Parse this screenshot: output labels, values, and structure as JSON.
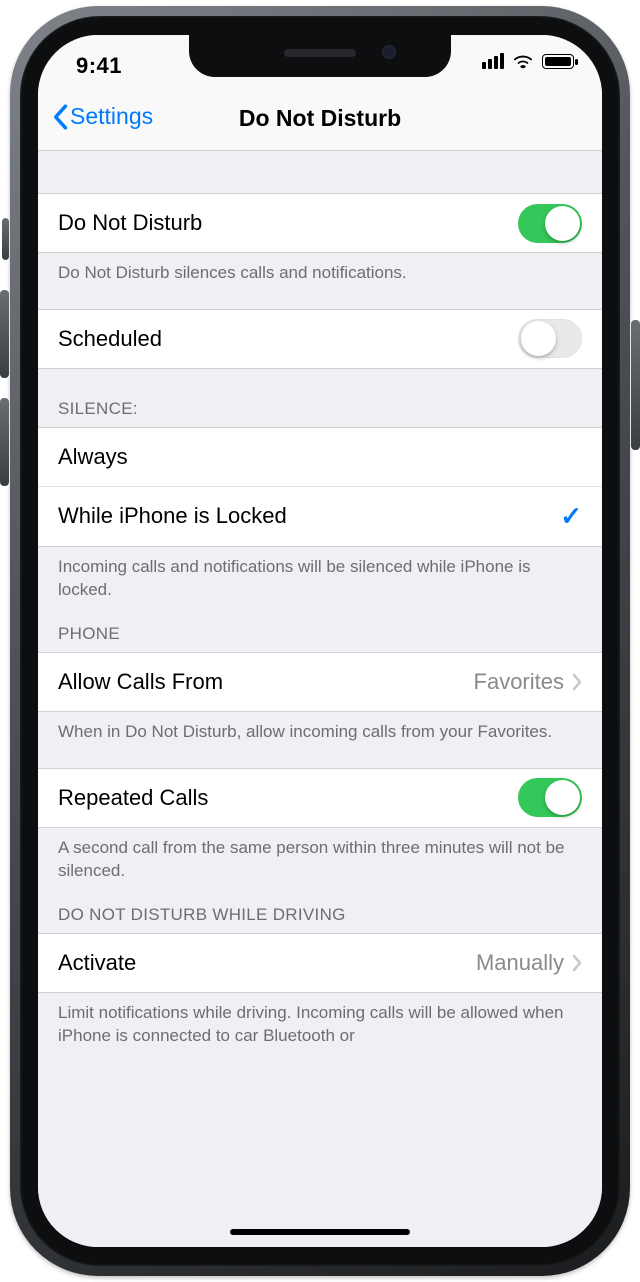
{
  "statusbar": {
    "time": "9:41"
  },
  "nav": {
    "back_label": "Settings",
    "title": "Do Not Disturb"
  },
  "section1": {
    "dnd_label": "Do Not Disturb",
    "dnd_on": true,
    "dnd_footer": "Do Not Disturb silences calls and notifications.",
    "scheduled_label": "Scheduled",
    "scheduled_on": false
  },
  "silence": {
    "header": "SILENCE:",
    "always_label": "Always",
    "locked_label": "While iPhone is Locked",
    "selected": "locked",
    "footer": "Incoming calls and notifications will be silenced while iPhone is locked."
  },
  "phone": {
    "header": "PHONE",
    "allow_label": "Allow Calls From",
    "allow_value": "Favorites",
    "allow_footer": "When in Do Not Disturb, allow incoming calls from your Favorites.",
    "repeated_label": "Repeated Calls",
    "repeated_on": true,
    "repeated_footer": "A second call from the same person within three minutes will not be silenced."
  },
  "driving": {
    "header": "DO NOT DISTURB WHILE DRIVING",
    "activate_label": "Activate",
    "activate_value": "Manually",
    "footer": "Limit notifications while driving. Incoming calls will be allowed when iPhone is connected to car Bluetooth or"
  }
}
